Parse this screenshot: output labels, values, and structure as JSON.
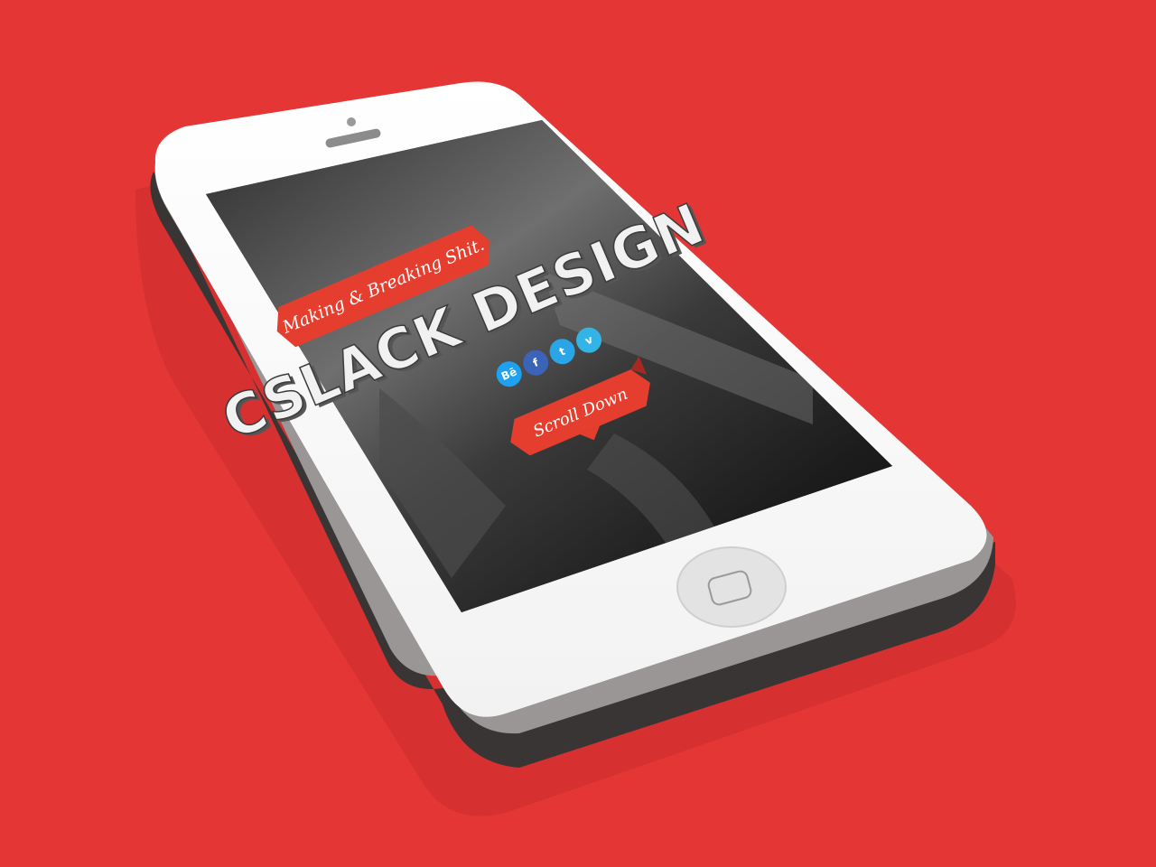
{
  "background_color": "#e53636",
  "phone": {
    "body_color": "#ffffff",
    "side_color": "#3a3535",
    "home_button": "home-button"
  },
  "site": {
    "tagline": "Making & Breaking Shit.",
    "brand": "CSLACK DESIGN",
    "scroll_label": "Scroll Down",
    "ribbon_color": "#e53e2f",
    "social_links": [
      {
        "label": "Bē",
        "icon": "behance-icon",
        "color": "#1ea1f1"
      },
      {
        "label": "f",
        "icon": "facebook-icon",
        "color": "#3b63b8"
      },
      {
        "label": "t",
        "icon": "twitter-icon",
        "color": "#2aa6e8"
      },
      {
        "label": "v",
        "icon": "vimeo-icon",
        "color": "#32b4e6"
      }
    ]
  }
}
